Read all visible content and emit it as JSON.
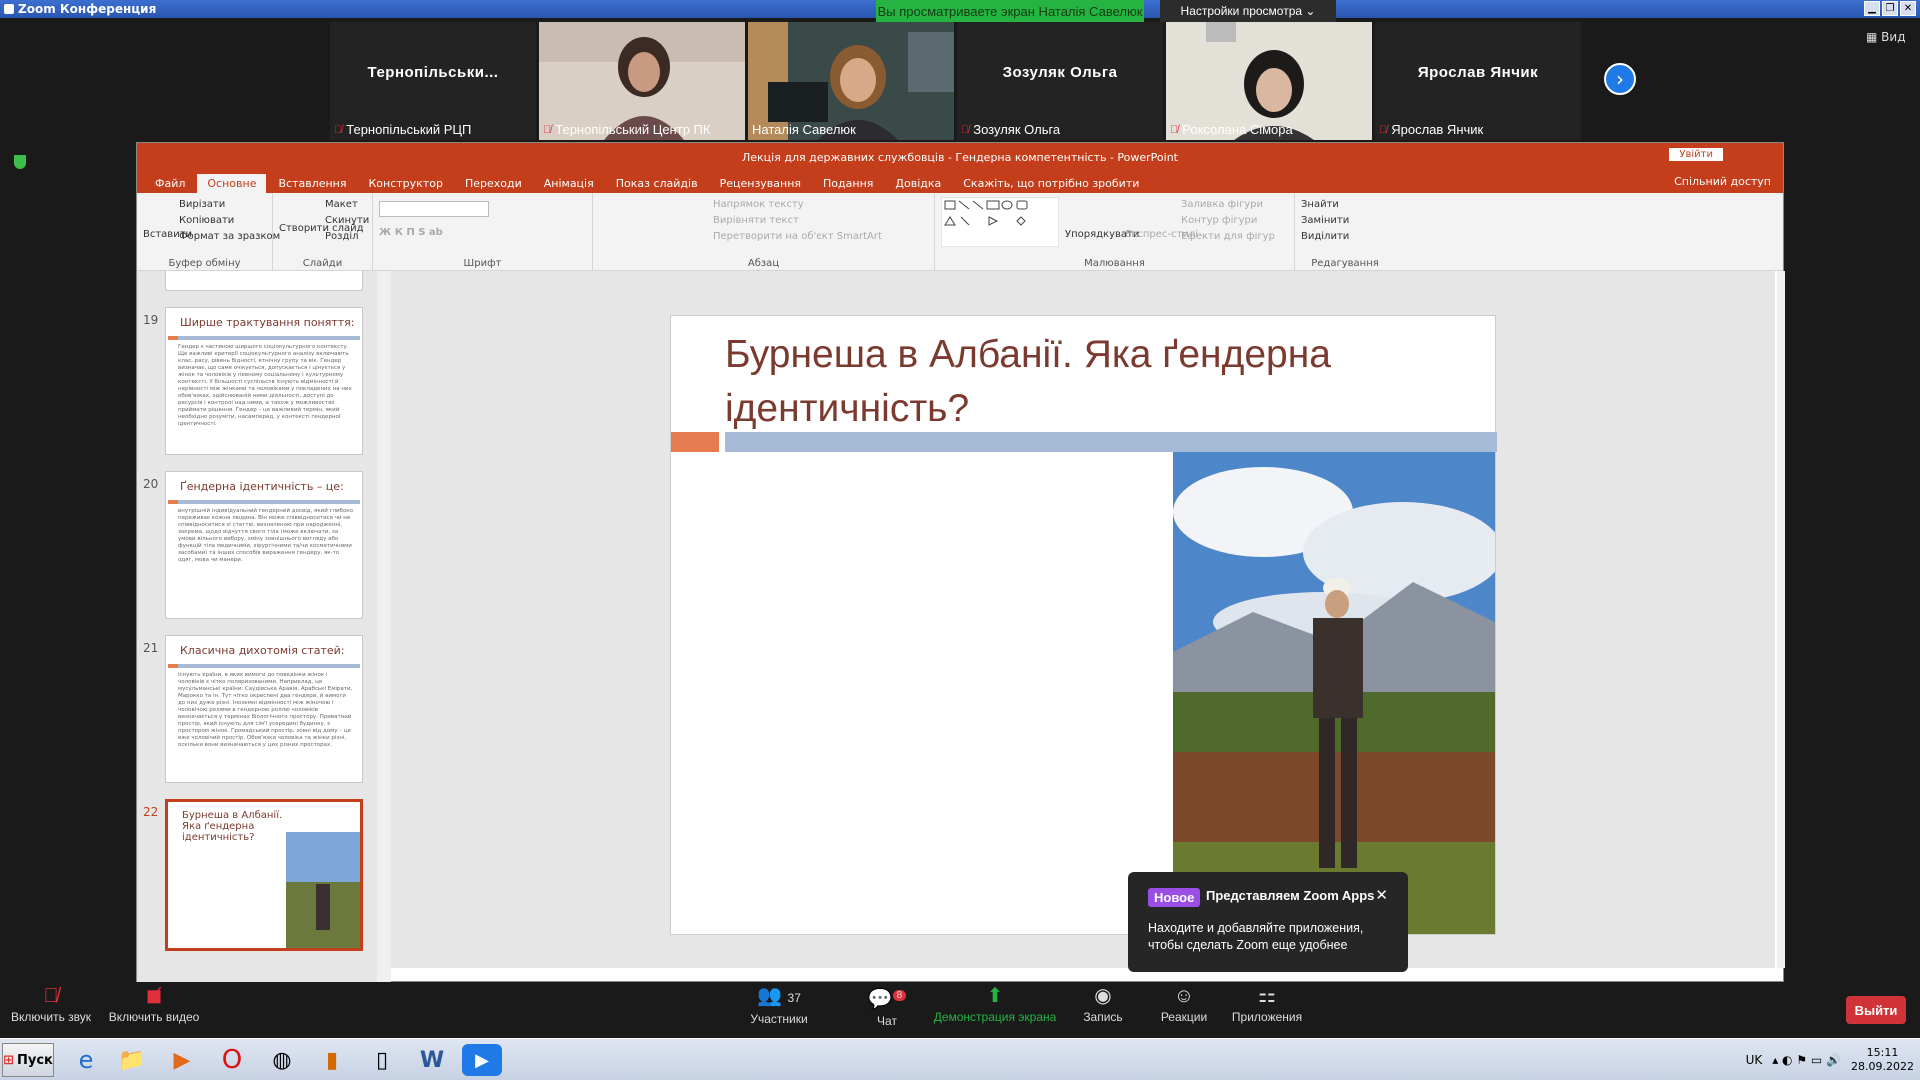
{
  "window": {
    "title": "Zoom Конференция"
  },
  "share_banner": "Вы просматриваете экран Наталія Савелюк",
  "view_settings": "Настройки просмотра",
  "view_button": "Вид",
  "participants": [
    {
      "name": "Тернопільськи...",
      "label": "Тернопільський РЦП",
      "video": false
    },
    {
      "name": "",
      "label": "Тернопільський Центр ПК",
      "video": true
    },
    {
      "name": "",
      "label": "Наталія Савелюк",
      "video": true
    },
    {
      "name": "Зозуляк Ольга",
      "label": "Зозуляк Ольга",
      "video": false
    },
    {
      "name": "",
      "label": "Роксолана Сімора",
      "video": true
    },
    {
      "name": "Ярослав Янчик",
      "label": "Ярослав Янчик",
      "video": false
    }
  ],
  "ppt": {
    "title": "Лекція для державних службовців - Гендерна компетентність - PowerPoint",
    "login": "Увійти",
    "share": "Спільний доступ",
    "tabs": [
      "Файл",
      "Основне",
      "Вставлення",
      "Конструктор",
      "Переходи",
      "Анімація",
      "Показ слайдів",
      "Рецензування",
      "Подання",
      "Довідка",
      "Скажіть, що потрібно зробити"
    ],
    "ribbon": {
      "paste": "Вставити",
      "cut": "Вирізати",
      "copy": "Копіювати",
      "format": "Формат за зразком",
      "g_clip": "Буфер обміну",
      "new_slide": "Створити слайд",
      "layout": "Макет",
      "reset": "Скинути",
      "section": "Розділ",
      "g_slides": "Слайди",
      "g_font": "Шрифт",
      "text_dir": "Напрямок тексту",
      "align_text": "Вирівняти текст",
      "smartart": "Перетворити на об'єкт SmartArt",
      "g_para": "Абзац",
      "arrange": "Упорядкувати",
      "quick_styles": "Експрес-стилі",
      "fill": "Заливка фігури",
      "outline": "Контур фігури",
      "effects": "Ефекти для фігур",
      "g_draw": "Малювання",
      "find": "Знайти",
      "replace": "Замінити",
      "select": "Виділити",
      "g_edit": "Редагування"
    },
    "thumbs": [
      {
        "num": "19",
        "title": "Ширше трактування поняття:",
        "text": "Гендер є частиною ширшого соціокультурного контексту. Ще важливі критерії соціокультурного аналізу включають клас, расу, рівень бідності, етнічну групу та вік. Гендер визначає, що саме очікується, допускається і цінується у жінок та чоловіків у певному соціальному і культурному контексті. У більшості суспільств існують відмінності й нерівності між жінками та чоловіками у покладених на них обов'язках, здійснюваній ними діяльності, доступі до ресурсів і контролі над ними, а також у можливостях приймати рішення. Гендер – це важливий термін, який необхідно розуміти, насамперед, у контексті гендерної ідентичності."
      },
      {
        "num": "20",
        "title": "Ґендерна ідентичність – це:",
        "text": "внутрішній індивідуальний гендерний досвід, який глибоко переживає кожна людина. Він може співвідноситися чи не співвідноситися зі статтю, визначеною при народженні, зокрема, щодо відчуття свого тіла (може включати, за умови вільного вибору, зміну зовнішнього вигляду або функцій тіла медичними, хірургічними та/чи косметичними засобами) та інших способів вираження гендеру, як-то одяг, мова чи манери."
      },
      {
        "num": "21",
        "title": "Класична дихотомія статей:",
        "text": "існують країни, в яких вимоги до поведінки жінок і чоловіків є чітко поляризованими. Наприклад, це мусульманські країни: Саудівська Аравія, Арабські Емірати, Марокко та ін. Тут чітко окреслені два гендери, й вимоги до них дуже різні. Іноземні відмінності між жіночою і чоловічою ролями в гендерною роллю чоловіків визначається у термінах біологічного простору. Приватний простір, який існують для сім'ї усередині будинку, є простором жінок. Громадський простір, зовні від дому – це вже чоловічий простір. Обов'язки чоловіка та жінки різні, оскільки вони визначаються у цих різних просторах."
      },
      {
        "num": "22",
        "title": "Бурнеша в Албанії. Яка ґендерна ідентичність?",
        "text": ""
      }
    ],
    "slide_title": "Бурнеша в Албанії. Яка ґендерна ідентичність?"
  },
  "toast": {
    "badge": "Новое",
    "title": "Представляем Zoom Apps",
    "body": "Находите и добавляйте приложения, чтобы сделать Zoom еще удобнее"
  },
  "zoom_bar": {
    "mute": "Включить звук",
    "video": "Включить видео",
    "participants": "Участники",
    "participants_count": "37",
    "chat": "Чат",
    "chat_badge": "8",
    "share": "Демонстрация экрана",
    "record": "Запись",
    "reactions": "Реакции",
    "apps": "Приложения",
    "exit": "Выйти"
  },
  "taskbar": {
    "start": "Пуск",
    "lang": "UK",
    "time": "15:11",
    "date": "28.09.2022"
  }
}
